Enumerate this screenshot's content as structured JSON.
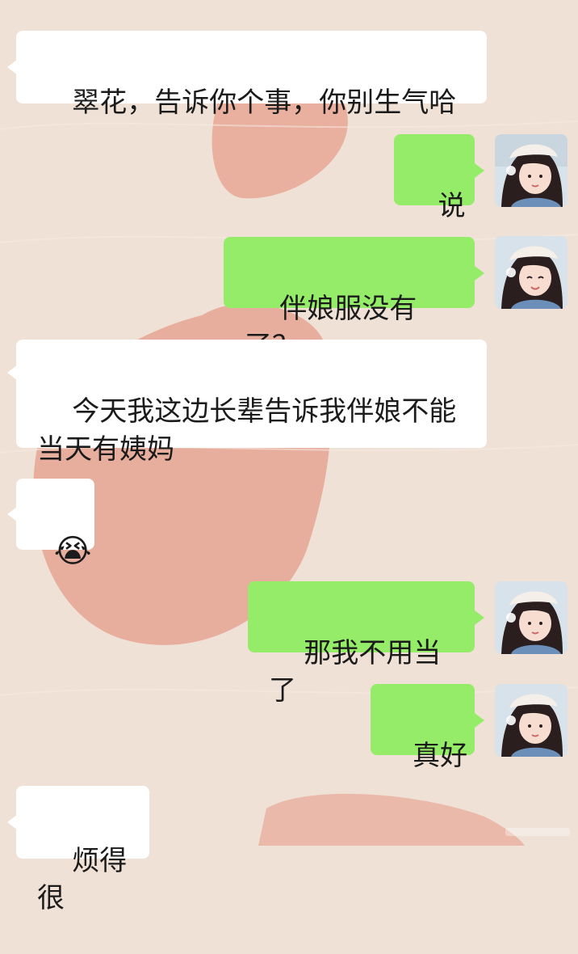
{
  "chat": {
    "messages": [
      {
        "side": "in",
        "text": "翠花，告诉你个事，你别生气哈"
      },
      {
        "side": "out",
        "text": "说"
      },
      {
        "side": "out",
        "text": "伴娘服没有了？"
      },
      {
        "side": "in",
        "text": "今天我这边长辈告诉我伴娘不能\n当天有姨妈"
      },
      {
        "side": "in",
        "text": "😭"
      },
      {
        "side": "out",
        "text": "那我不用当了"
      },
      {
        "side": "out",
        "text": "真好"
      },
      {
        "side": "in",
        "text": "烦得很"
      }
    ]
  },
  "avatar": {
    "description_icon": "girl-with-beret-avatar"
  },
  "colors": {
    "background": "#efe1d6",
    "incoming_bubble": "#ffffff",
    "outgoing_bubble": "#95ec69",
    "brush_strokes": "#e8a696"
  }
}
